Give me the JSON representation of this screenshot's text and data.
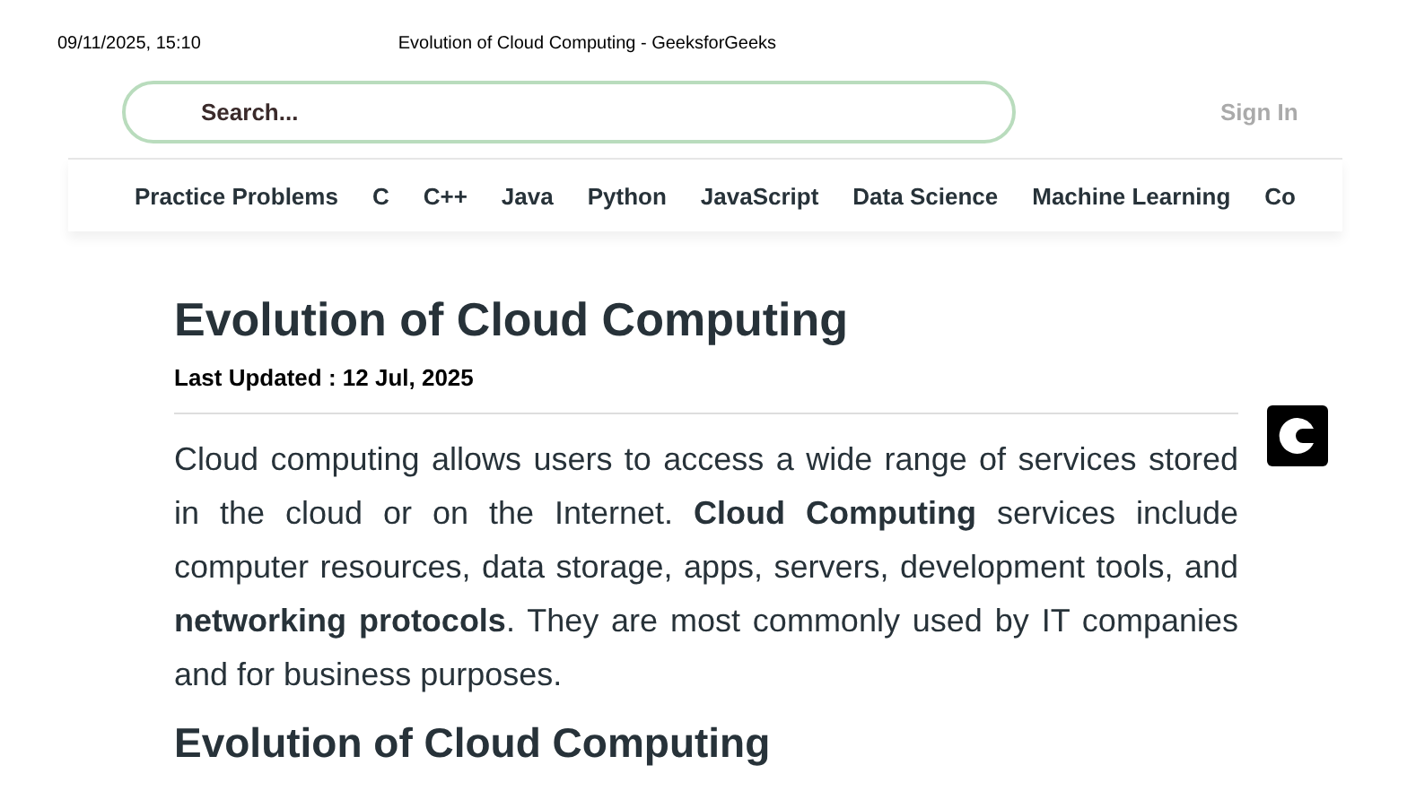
{
  "print_header": {
    "date": "09/11/2025, 15:10",
    "title": "Evolution of Cloud Computing - GeeksforGeeks"
  },
  "search": {
    "placeholder": "Search..."
  },
  "sign_in": "Sign In",
  "nav": [
    "Practice Problems",
    "C",
    "C++",
    "Java",
    "Python",
    "JavaScript",
    "Data Science",
    "Machine Learning",
    "Co"
  ],
  "article": {
    "title": "Evolution of Cloud Computing",
    "updated": "Last Updated : 12 Jul, 2025",
    "paragraph": "Cloud computing allows users to access a wide range of services stored in the cloud or on the Internet. **Cloud Computing** services include computer resources, data storage, apps, servers, development tools, and **networking protocols**. They are most commonly used by IT companies and for business purposes.",
    "heading": "Evolution of Cloud Computing"
  }
}
